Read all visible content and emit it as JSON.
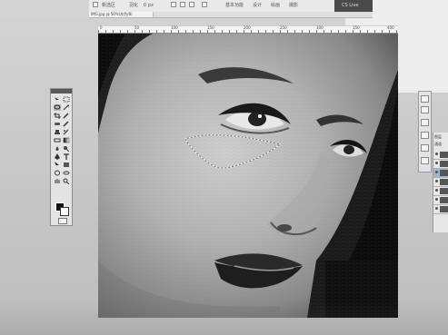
{
  "options_bar": {
    "mode_label": "新选区",
    "feather_label": "羽化",
    "feather_value": "0 px",
    "tabs": [
      "基本功能",
      "设计",
      "绘画",
      "摄影"
    ],
    "workspace_label": "CS Live"
  },
  "document": {
    "tab_label": "IMG.jpg @ 50%(灰色/8)"
  },
  "ruler": {
    "labels": [
      "0",
      "50",
      "100",
      "150",
      "200",
      "250",
      "300",
      "350",
      "400"
    ]
  },
  "toolbox": {
    "tools": [
      "move",
      "marquee",
      "lasso",
      "quick-select",
      "crop",
      "eyedropper",
      "spot-heal",
      "brush",
      "clone-stamp",
      "history-brush",
      "eraser",
      "gradient",
      "blur",
      "dodge",
      "pen",
      "type",
      "path-select",
      "shape",
      "hand",
      "zoom"
    ],
    "active_tool": "lasso",
    "foreground_color": "#111111",
    "background_color": "#ffffff"
  },
  "layers_panel": {
    "title": "图层",
    "tab_label": "通道",
    "selected_layer": "背景"
  },
  "canvas": {
    "mode": "grayscale",
    "selection": "lasso-under-eye"
  },
  "colors": {
    "accent": "#9db7d8",
    "chrome": "#e4e4e4",
    "workspace": "#c8c8c8"
  }
}
